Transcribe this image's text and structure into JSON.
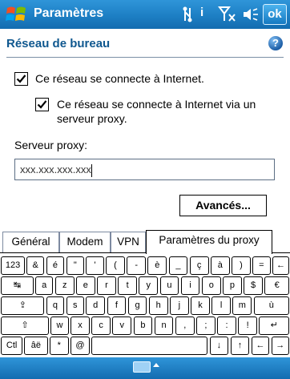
{
  "titlebar": {
    "app_title": "Paramètres",
    "ok_label": "ok",
    "info_glyph": "i"
  },
  "header": {
    "page_title": "Réseau de bureau",
    "help_glyph": "?"
  },
  "form": {
    "checkbox1": {
      "label": "Ce réseau se connecte à Internet.",
      "checked": true
    },
    "checkbox2": {
      "label_line1": "Ce réseau se connecte à Internet via un",
      "label_line2": "serveur proxy.",
      "checked": true
    },
    "proxy_label": "Serveur proxy:",
    "proxy_value": "xxx.xxx.xxx.xxx",
    "advanced_button": "Avancés..."
  },
  "tabs": [
    {
      "label": "Général"
    },
    {
      "label": "Modem"
    },
    {
      "label": "VPN"
    },
    {
      "label": "Paramètres du proxy",
      "active": true
    }
  ],
  "keyboard": {
    "row1": [
      "123",
      "&",
      "é",
      "\"",
      "'",
      "(",
      "-",
      "è",
      "_",
      "ç",
      "à",
      ")",
      "=",
      "←"
    ],
    "row2": [
      "↹",
      "a",
      "z",
      "e",
      "r",
      "t",
      "y",
      "u",
      "i",
      "o",
      "p",
      "$",
      "€"
    ],
    "row3": [
      "⇪",
      "q",
      "s",
      "d",
      "f",
      "g",
      "h",
      "j",
      "k",
      "l",
      "m",
      "ù"
    ],
    "row4": [
      "⇧",
      "w",
      "x",
      "c",
      "v",
      "b",
      "n",
      ",",
      ";",
      ":",
      "!",
      "↵"
    ],
    "row5": [
      "Ctl",
      "âë",
      "*",
      "@",
      "",
      "↓",
      "↑",
      "←",
      "→"
    ]
  },
  "icons": {
    "start": "windows-logo-icon",
    "connectivity": "connectivity-icon",
    "signal": "signal-no-service-icon",
    "volume": "speaker-icon",
    "keyboard": "keyboard-icon"
  },
  "colors": {
    "titlebar": "#1d7fc4",
    "header_text": "#10588f"
  }
}
